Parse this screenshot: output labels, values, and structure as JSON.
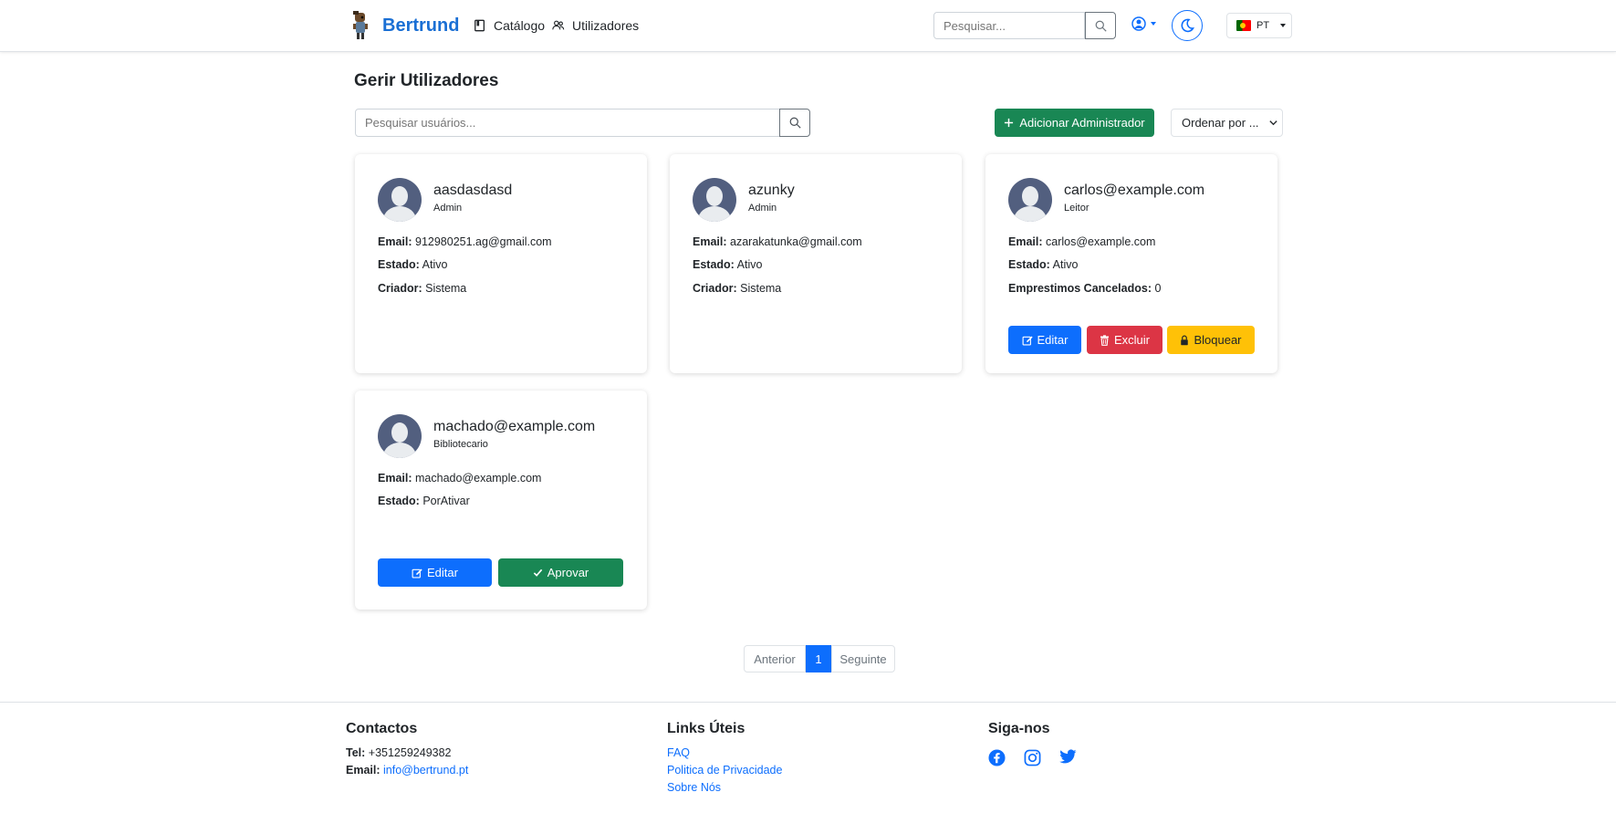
{
  "navbar": {
    "brand": "Bertrund",
    "catalog": "Catálogo",
    "users": "Utilizadores",
    "search_placeholder": "Pesquisar...",
    "language": "PT"
  },
  "page": {
    "title": "Gerir Utilizadores",
    "search_placeholder": "Pesquisar usuários...",
    "add_admin": "Adicionar Administrador",
    "sort": "Ordenar por ..."
  },
  "cards": [
    {
      "name": "aasdasdasd",
      "role": "Admin",
      "email_label": "Email:",
      "email": "912980251.ag@gmail.com",
      "status_label": "Estado:",
      "status": "Ativo",
      "creator_label": "Criador:",
      "creator": "Sistema"
    },
    {
      "name": "azunky",
      "role": "Admin",
      "email_label": "Email:",
      "email": "azarakatunka@gmail.com",
      "status_label": "Estado:",
      "status": "Ativo",
      "creator_label": "Criador:",
      "creator": "Sistema"
    },
    {
      "name": "carlos@example.com",
      "role": "Leitor",
      "email_label": "Email:",
      "email": "carlos@example.com",
      "status_label": "Estado:",
      "status": "Ativo",
      "cancelled_label": "Emprestimos Cancelados:",
      "cancelled": "0",
      "edit": "Editar",
      "delete": "Excluir",
      "block": "Bloquear"
    },
    {
      "name": "machado@example.com",
      "role": "Bibliotecario",
      "email_label": "Email:",
      "email": "machado@example.com",
      "status_label": "Estado:",
      "status": "PorAtivar",
      "edit": "Editar",
      "approve": "Aprovar"
    }
  ],
  "pagination": {
    "prev": "Anterior",
    "current": "1",
    "next": "Seguinte"
  },
  "footer": {
    "contacts_title": "Contactos",
    "tel_label": "Tel:",
    "tel": "+351259249382",
    "email_label": "Email:",
    "email": "info@bertrund.pt",
    "links_title": "Links Úteis",
    "links": [
      "FAQ",
      "Politica de Privacidade",
      "Sobre Nós"
    ],
    "follow_title": "Siga-nos"
  },
  "colors": {
    "primary": "#0d6efd",
    "success": "#198754",
    "danger": "#dc3545",
    "warning": "#ffc107",
    "brand": "#1a6fd4"
  },
  "icons": [
    "book-icon",
    "users-icon",
    "search-icon",
    "user-circle-icon",
    "moon-icon",
    "flag-pt-icon",
    "plus-icon",
    "chevron-down-icon",
    "edit-icon",
    "trash-icon",
    "lock-icon",
    "check-icon",
    "facebook-icon",
    "instagram-icon",
    "twitter-icon"
  ]
}
